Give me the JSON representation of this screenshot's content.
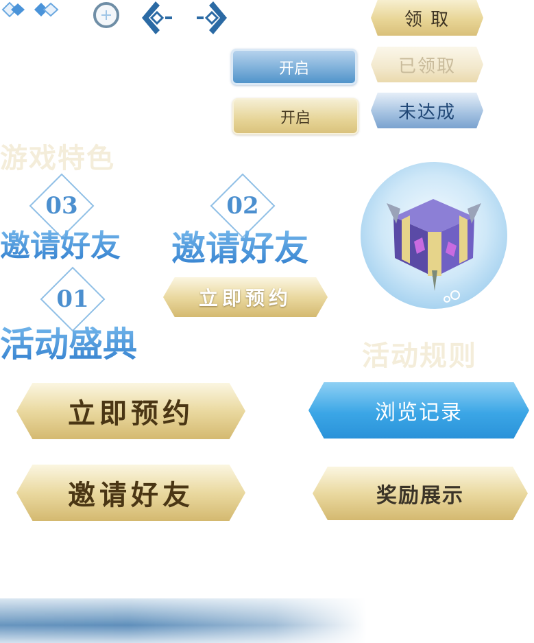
{
  "icons": {
    "diamond_pair": "diamond-pair-icon",
    "plus_circle": "plus-circle-icon",
    "arrow_left": "arrow-left-icon",
    "arrow_right": "arrow-right-icon",
    "treasure_chest": "treasure-chest-icon"
  },
  "buttons": {
    "claim": "领 取",
    "claimed": "已领取",
    "not_reached": "未达成",
    "open_blue": "开启",
    "open_gold": "开启",
    "reserve_now_small": "立即预约",
    "reserve_now_large": "立即预约",
    "invite_friends_large": "邀请好友",
    "browse_history": "浏览记录",
    "reward_display": "奖励展示"
  },
  "sections": {
    "game_features": "游戏特色",
    "event_rules": "活动规则"
  },
  "steps": [
    {
      "number": "03",
      "title": "邀请好友"
    },
    {
      "number": "02",
      "title": "邀请好友"
    },
    {
      "number": "01",
      "title": "活动盛典"
    }
  ],
  "colors": {
    "gold": "#e3cd8c",
    "blue": "#3a9ee3",
    "title_blue": "#2f7dcd",
    "text_dark": "#4a3614"
  }
}
